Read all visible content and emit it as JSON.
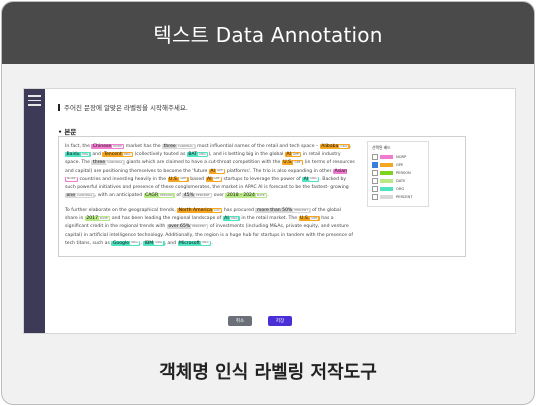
{
  "header": {
    "title": "텍스트 Data Annotation"
  },
  "footer": {
    "caption": "객체명 인식 라벨링 저작도구"
  },
  "tool": {
    "instruction": "주어진 문장에 알맞은 라벨링을 시작해주세요.",
    "section_label": "• 본문",
    "legend": {
      "title": "선택된 배드",
      "items": [
        {
          "label": "NORP",
          "color": "#f27bd0",
          "checked": false
        },
        {
          "label": "GPE",
          "color": "#f5a623",
          "checked": true
        },
        {
          "label": "PERSON",
          "color": "#7ed321",
          "checked": false
        },
        {
          "label": "DATE",
          "color": "#b8e986",
          "checked": false
        },
        {
          "label": "ORG",
          "color": "#50e3c2",
          "checked": false
        },
        {
          "label": "PERCENT",
          "color": "#d8d8d8",
          "checked": false
        }
      ]
    },
    "cancel_label": "취소",
    "save_label": "저장"
  }
}
